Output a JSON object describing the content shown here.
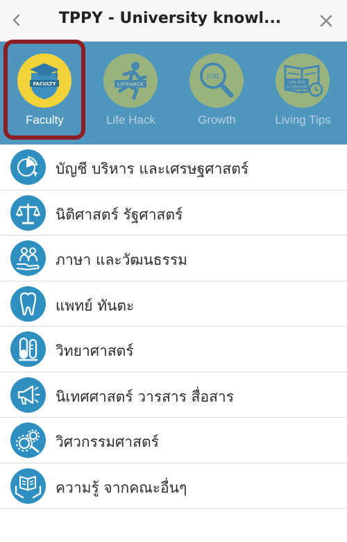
{
  "header": {
    "title": "TPPY - University knowl...",
    "back_icon": "chevron-left-icon",
    "close_icon": "close-icon"
  },
  "colors": {
    "tab_bar": "#4f96be",
    "badge_active": "#f2d33a",
    "highlight_border": "#8c1f24",
    "list_icon_bg": "#2f8fc0"
  },
  "tabs": [
    {
      "label": "Faculty",
      "badge_text": "FACULTY",
      "icon": "graduation-cap-icon",
      "active": true
    },
    {
      "label": "Life Hack",
      "badge_text": "LIFEHACK",
      "icon": "running-person-icon",
      "active": false
    },
    {
      "label": "Growth",
      "badge_text": "JOB",
      "icon": "magnifier-icon",
      "active": false
    },
    {
      "label": "Living Tips",
      "badge_text": "Life Skill & Lifestyle",
      "icon": "book-clock-icon",
      "active": false
    }
  ],
  "faculties": [
    {
      "label": "บัญชี บริหาร และเศรษฐศาสตร์",
      "icon": "pie-chart-icon"
    },
    {
      "label": "นิติศาสตร์ รัฐศาสตร์",
      "icon": "scales-icon"
    },
    {
      "label": "ภาษา และวัฒนธรรม",
      "icon": "people-hand-icon"
    },
    {
      "label": "แพทย์ ทันตะ",
      "icon": "tooth-icon"
    },
    {
      "label": "วิทยาศาสตร์",
      "icon": "test-tube-icon"
    },
    {
      "label": "นิเทศศาสตร์ วารสาร สื่อสาร",
      "icon": "megaphone-icon"
    },
    {
      "label": "วิศวกรรมศาสตร์",
      "icon": "gears-icon"
    },
    {
      "label": "ความรู้ จากคณะอื่นๆ",
      "icon": "open-book-hands-icon"
    }
  ]
}
